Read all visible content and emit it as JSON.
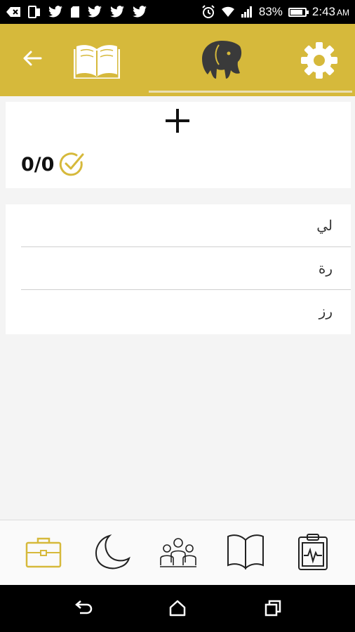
{
  "status_bar": {
    "battery": "83%",
    "battery_level": 0.83,
    "time": "2:43",
    "ampm": "AM"
  },
  "app_bar": {
    "active_tab": "elephant",
    "colors": {
      "background": "#d6b93b",
      "icon": "#ffffff",
      "elephant": "#3a3a3a"
    }
  },
  "card": {
    "score": "0/0",
    "accent": "#d6b93b"
  },
  "list": {
    "items": [
      {
        "label": "لي"
      },
      {
        "label": "رة"
      },
      {
        "label": "رز"
      }
    ]
  },
  "bottom_tabs": {
    "active": "briefcase",
    "items": [
      "briefcase-icon",
      "moon-icon",
      "people-icon",
      "open-book-icon",
      "clipboard-pulse-icon"
    ]
  },
  "nav_bar": {
    "items": [
      "back-icon",
      "home-icon",
      "recents-icon"
    ]
  }
}
